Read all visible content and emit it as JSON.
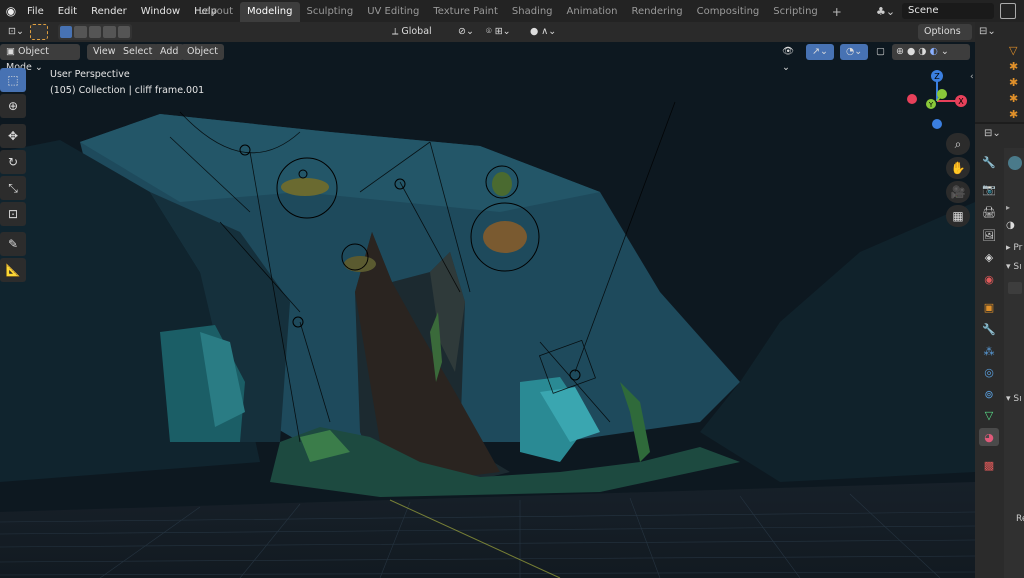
{
  "menu": {
    "file": "File",
    "edit": "Edit",
    "render": "Render",
    "window": "Window",
    "help": "Help"
  },
  "workspaces": [
    {
      "label": "Layout",
      "active": false
    },
    {
      "label": "Modeling",
      "active": true
    },
    {
      "label": "Sculpting",
      "active": false
    },
    {
      "label": "UV Editing",
      "active": false
    },
    {
      "label": "Texture Paint",
      "active": false
    },
    {
      "label": "Shading",
      "active": false
    },
    {
      "label": "Animation",
      "active": false
    },
    {
      "label": "Rendering",
      "active": false
    },
    {
      "label": "Compositing",
      "active": false
    },
    {
      "label": "Scripting",
      "active": false
    }
  ],
  "add_tab": "+",
  "scene": {
    "name": "Scene"
  },
  "tool_header": {
    "orientation": "Global",
    "options": "Options"
  },
  "viewport_header": {
    "mode": "Object Mode",
    "view": "View",
    "select": "Select",
    "add": "Add",
    "object": "Object"
  },
  "overlay": {
    "perspective": "User Perspective",
    "collection": "(105) Collection | cliff frame.001"
  },
  "gizmo": {
    "z": "Z",
    "y": "Y",
    "x": "X"
  },
  "properties": {
    "row1": "Pr",
    "row2": "Sı",
    "row3": "Sı",
    "row4": "Re"
  },
  "colors": {
    "accent": "#4772b3",
    "active_tab": "#3d3d3d",
    "gizmo_x": "#e8405a",
    "gizmo_y": "#8ac83a",
    "gizmo_z": "#3b7fe0"
  }
}
